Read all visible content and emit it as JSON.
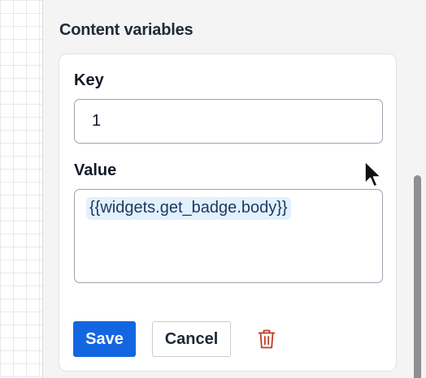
{
  "section": {
    "title": "Content variables"
  },
  "key_field": {
    "label": "Key",
    "value": "1"
  },
  "value_field": {
    "label": "Value",
    "token": "{{widgets.get_badge.body}}"
  },
  "actions": {
    "save_label": "Save",
    "cancel_label": "Cancel",
    "delete_icon": "trash-icon"
  },
  "colors": {
    "primary": "#1466e0",
    "danger": "#c0392b",
    "token_bg": "#e3f0fd"
  }
}
